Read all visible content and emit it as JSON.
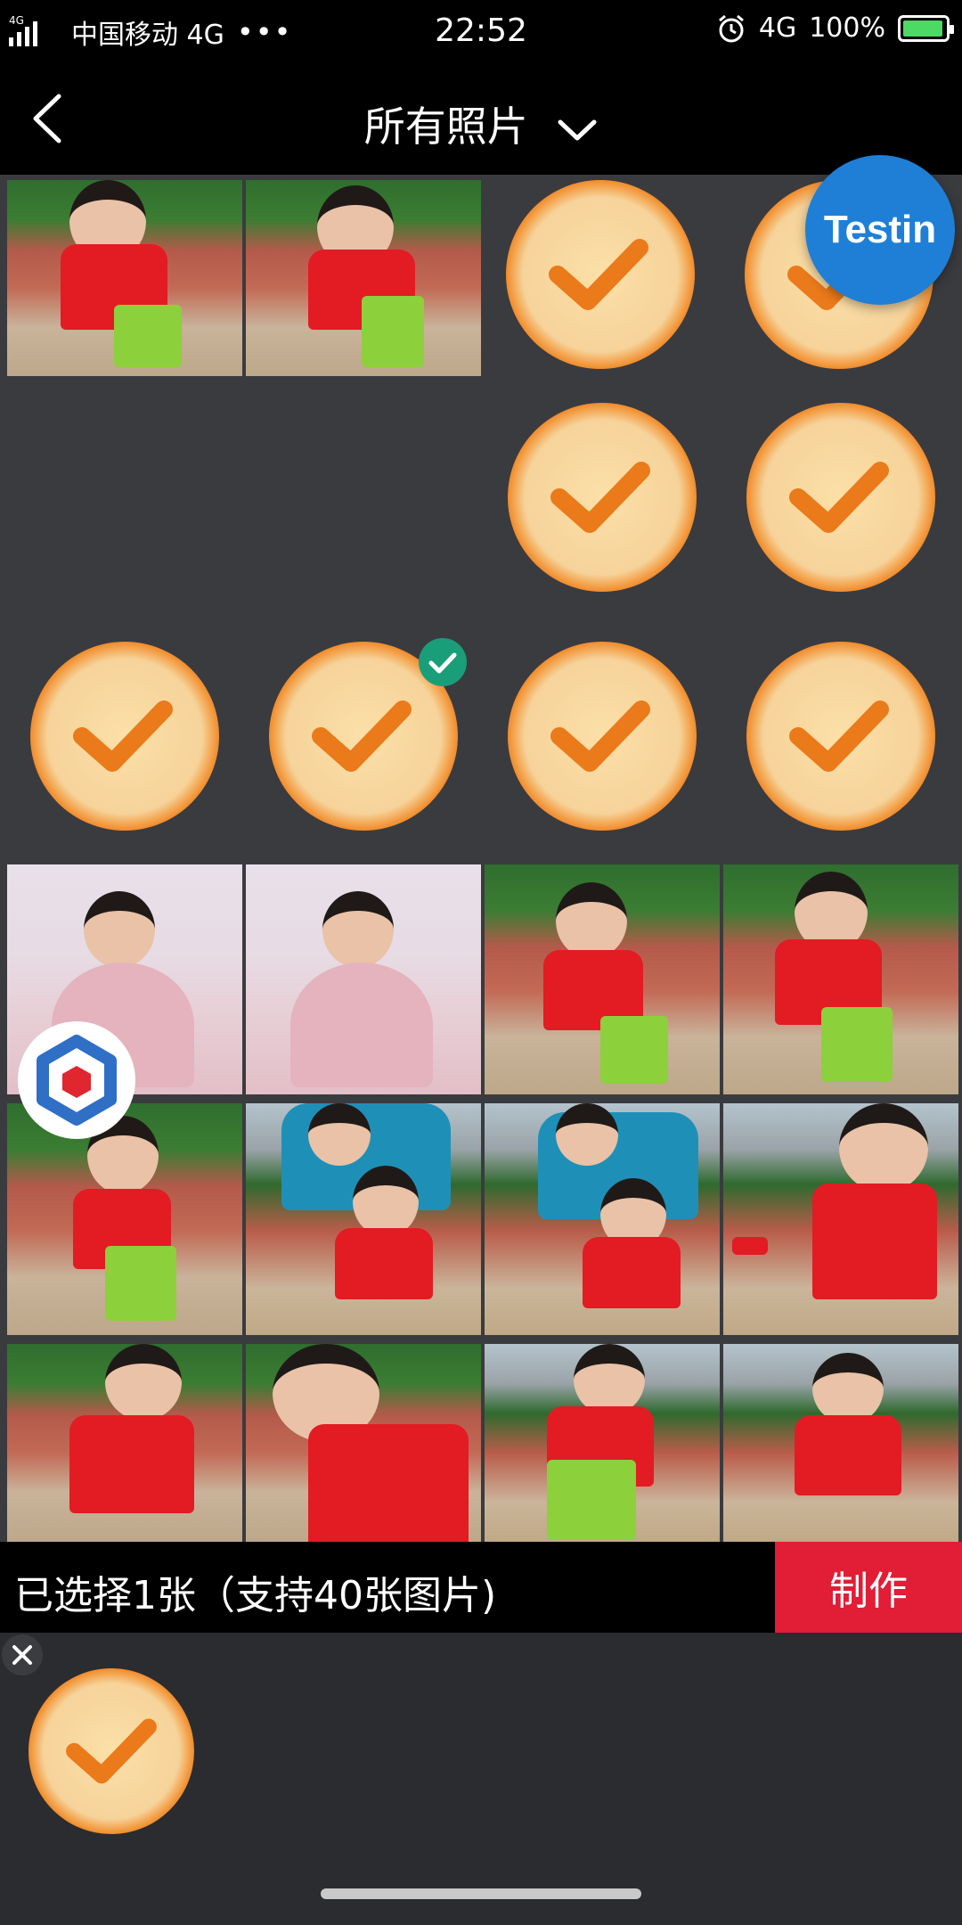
{
  "status_bar": {
    "network_tag": "4G",
    "carrier": "中国移动 4G",
    "more": "•••",
    "time": "22:52",
    "network": "4G",
    "battery": "100%",
    "icons": [
      "signal-icon",
      "alarm-icon",
      "battery-charging-icon"
    ]
  },
  "header": {
    "title": "所有照片",
    "back_icon": "chevron-left-icon",
    "dropdown_icon": "chevron-down-icon"
  },
  "overlays": {
    "testin_label": "Testin",
    "floating_icon": "hexagon-logo-icon"
  },
  "grid": {
    "columns": 4,
    "rows": [
      [
        "photo-beach",
        "photo-beach",
        "check-tile",
        "check-tile"
      ],
      [
        "empty",
        "empty",
        "check-tile",
        "check-tile"
      ],
      [
        "check-tile",
        "check-tile-selected",
        "check-tile",
        "check-tile"
      ],
      [
        "photo-pink-dress",
        "photo-pink-dress",
        "photo-beach",
        "photo-beach"
      ],
      [
        "photo-beach",
        "photo-dad-son",
        "photo-dad-son",
        "photo-shovel"
      ],
      [
        "photo-shovel",
        "photo-close",
        "photo-bucket",
        "photo-city"
      ]
    ]
  },
  "selection": {
    "summary": "已选择1张（支持40张图片)",
    "make_button": "制作",
    "remove_icon": "close-icon"
  },
  "colors": {
    "accent": "#e21d36",
    "check_orange": "#ea7a1a",
    "selected_badge": "#1a9e7a",
    "testin_blue": "#1f7fd6"
  }
}
